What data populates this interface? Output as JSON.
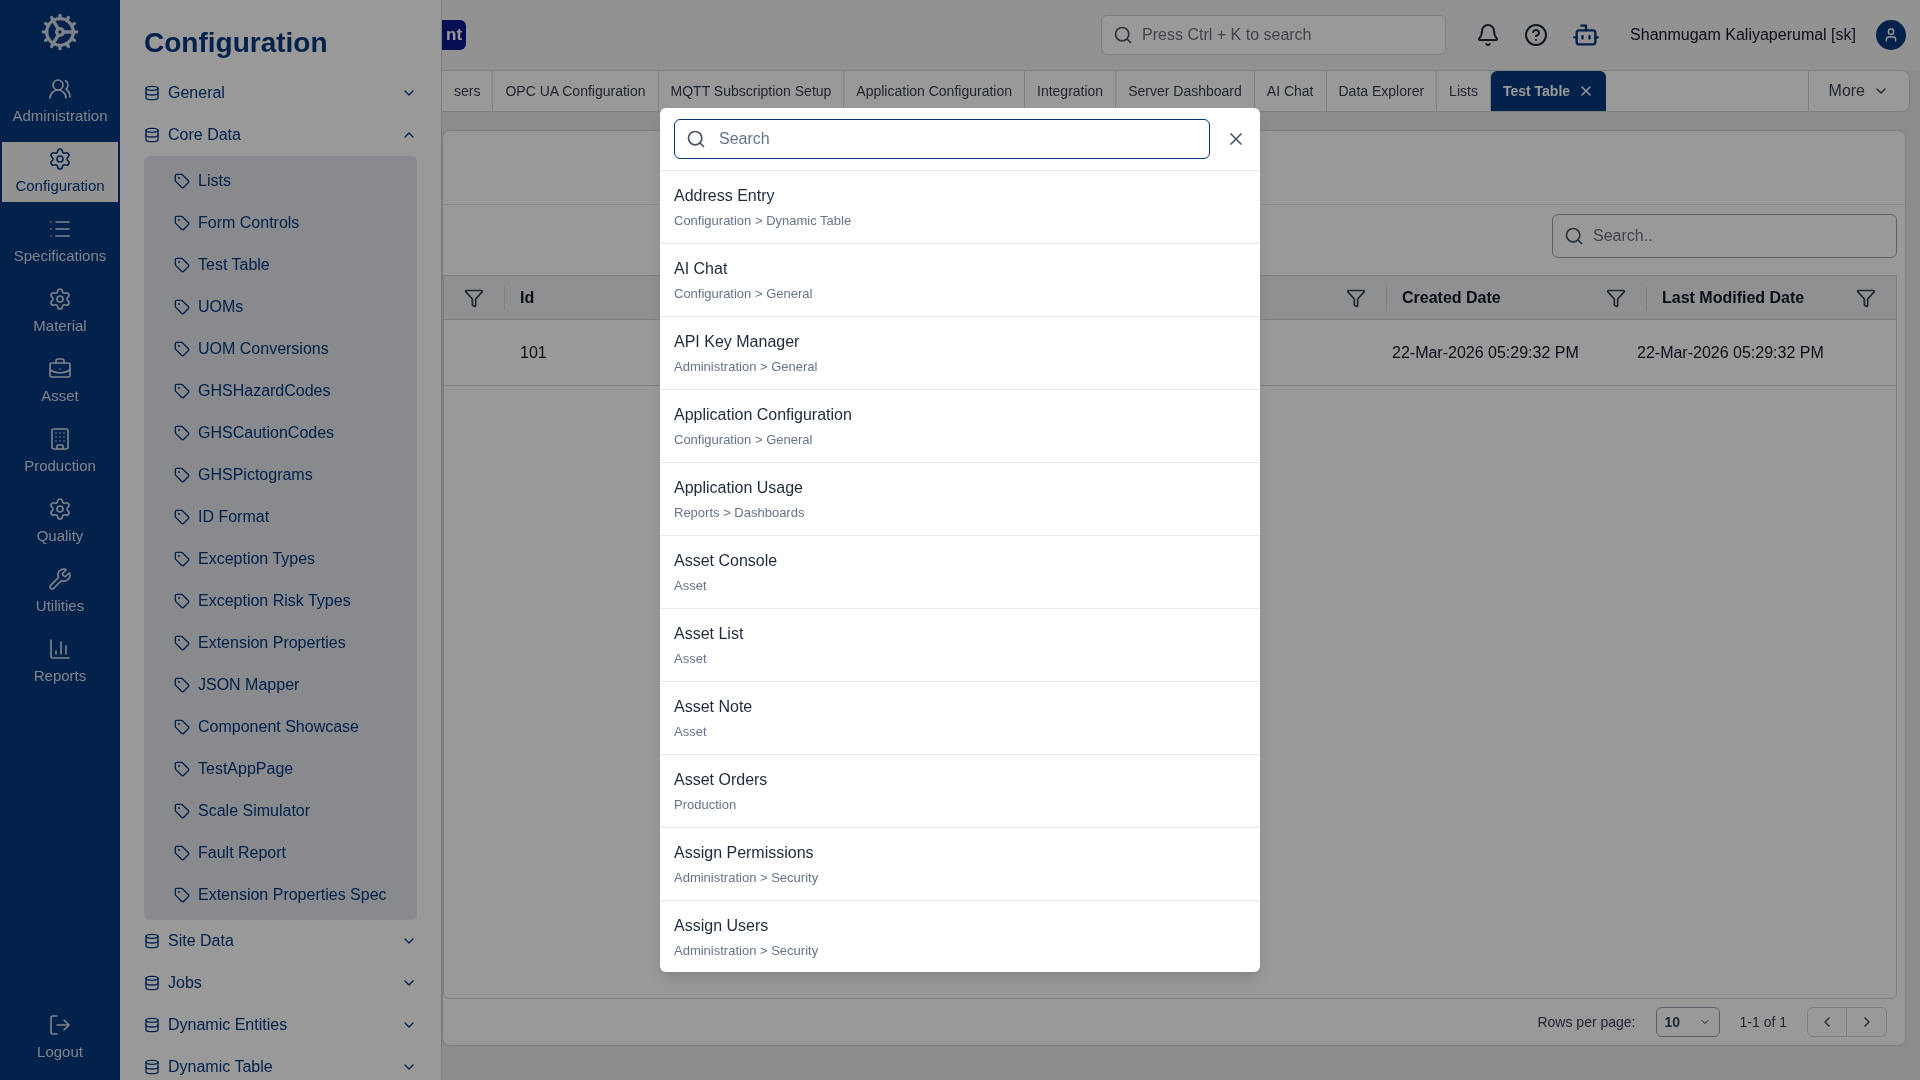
{
  "rail": {
    "items": [
      {
        "label": "Administration",
        "selected": false
      },
      {
        "label": "Configuration",
        "selected": true
      },
      {
        "label": "Specifications",
        "selected": false
      },
      {
        "label": "Material",
        "selected": false
      },
      {
        "label": "Asset",
        "selected": false
      },
      {
        "label": "Production",
        "selected": false
      },
      {
        "label": "Quality",
        "selected": false
      },
      {
        "label": "Utilities",
        "selected": false
      },
      {
        "label": "Reports",
        "selected": false
      }
    ],
    "logout": "Logout"
  },
  "config_panel": {
    "title": "Configuration",
    "sections": [
      {
        "label": "General",
        "expanded": false
      },
      {
        "label": "Core Data",
        "expanded": true,
        "children": [
          "Lists",
          "Form Controls",
          "Test Table",
          "UOMs",
          "UOM Conversions",
          "GHSHazardCodes",
          "GHSCautionCodes",
          "GHSPictograms",
          "ID Format",
          "Exception Types",
          "Exception Risk Types",
          "Extension Properties",
          "JSON Mapper",
          "Component Showcase",
          "TestAppPage",
          "Scale Simulator",
          "Fault Report",
          "Extension Properties Spec"
        ]
      },
      {
        "label": "Site Data",
        "expanded": false
      },
      {
        "label": "Jobs",
        "expanded": false
      },
      {
        "label": "Dynamic Entities",
        "expanded": false
      },
      {
        "label": "Dynamic Table",
        "expanded": false
      }
    ]
  },
  "header": {
    "badge": "nt",
    "search": {
      "placeholder": "Press Ctrl + K to search"
    },
    "user": "Shanmugam Kaliyaperumal [sk]"
  },
  "tabs": [
    {
      "label": "sers",
      "selected": false
    },
    {
      "label": "OPC UA Configuration",
      "selected": false
    },
    {
      "label": "MQTT Subscription Setup",
      "selected": false
    },
    {
      "label": "Application Configuration",
      "selected": false
    },
    {
      "label": "Integration",
      "selected": false
    },
    {
      "label": "Server Dashboard",
      "selected": false
    },
    {
      "label": "AI Chat",
      "selected": false
    },
    {
      "label": "Data Explorer",
      "selected": false
    },
    {
      "label": "Lists",
      "selected": false
    },
    {
      "label": "Test Table",
      "selected": true
    }
  ],
  "more": "More",
  "table": {
    "search": {
      "placeholder": "Search.."
    },
    "columns": [
      "Id",
      "Created Date",
      "Last Modified Date"
    ],
    "rows": [
      [
        "101",
        "22-Mar-2026 05:29:32 PM",
        "22-Mar-2026 05:29:32 PM"
      ]
    ]
  },
  "pagination": {
    "rows_per_page_label": "Rows per page:",
    "rows_per_page": "10",
    "range": "1-1 of 1"
  },
  "search_dialog": {
    "search": {
      "placeholder": "Search"
    },
    "results": [
      {
        "title": "Address Entry",
        "path": "Configuration > Dynamic Table"
      },
      {
        "title": "AI Chat",
        "path": "Configuration > General"
      },
      {
        "title": "API Key Manager",
        "path": "Administration > General"
      },
      {
        "title": "Application Configuration",
        "path": "Configuration > General"
      },
      {
        "title": "Application Usage",
        "path": "Reports > Dashboards"
      },
      {
        "title": "Asset Console",
        "path": "Asset"
      },
      {
        "title": "Asset List",
        "path": "Asset"
      },
      {
        "title": "Asset Note",
        "path": "Asset"
      },
      {
        "title": "Asset Orders",
        "path": "Production"
      },
      {
        "title": "Assign Permissions",
        "path": "Administration > Security"
      },
      {
        "title": "Assign Users",
        "path": "Administration > Security"
      }
    ]
  }
}
